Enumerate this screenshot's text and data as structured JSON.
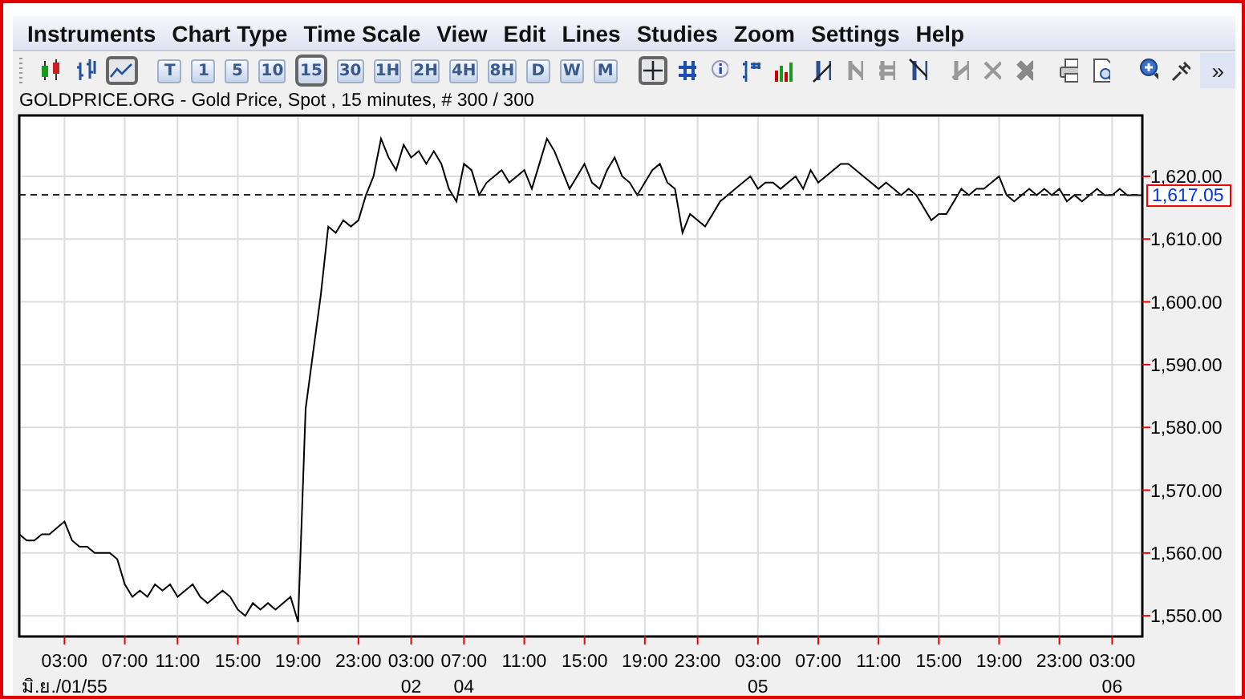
{
  "menu": [
    "Instruments",
    "Chart Type",
    "Time Scale",
    "View",
    "Edit",
    "Lines",
    "Studies",
    "Zoom",
    "Settings",
    "Help"
  ],
  "chart_types": [
    {
      "selected": false
    },
    {
      "selected": false
    },
    {
      "selected": true
    }
  ],
  "timescales": [
    {
      "label": "T",
      "selected": false
    },
    {
      "label": "1",
      "selected": false
    },
    {
      "label": "5",
      "selected": false
    },
    {
      "label": "10",
      "selected": false
    },
    {
      "label": "15",
      "selected": true
    },
    {
      "label": "30",
      "selected": false
    },
    {
      "label": "1H",
      "selected": false
    },
    {
      "label": "2H",
      "selected": false
    },
    {
      "label": "4H",
      "selected": false
    },
    {
      "label": "8H",
      "selected": false
    },
    {
      "label": "D",
      "selected": false
    },
    {
      "label": "W",
      "selected": false
    },
    {
      "label": "M",
      "selected": false
    }
  ],
  "crosshair": {
    "selected": true
  },
  "overflow": "»",
  "chart": {
    "title": "GOLDPRICE.ORG - Gold Price, Spot , 15 minutes, # 300 / 300",
    "time_labels": [
      "03:00",
      "07:00",
      "11:00",
      "15:00",
      "19:00",
      "23:00",
      "03:00",
      "07:00",
      "11:00",
      "15:00",
      "19:00",
      "23:00",
      "03:00",
      "07:00",
      "11:00",
      "15:00",
      "19:00",
      "23:00",
      "03:00"
    ],
    "date_labels": [
      "มิ.ย./01/55",
      "02",
      "04",
      "05",
      "06"
    ],
    "chart_data": {
      "type": "line",
      "grid": true,
      "ylim": [
        1546.7,
        1629.7
      ],
      "ref_lines": [
        {
          "axis": "y",
          "value": 1617.05,
          "label": "1,617.05"
        }
      ],
      "yticks": [
        {
          "value": 1550,
          "label": "1,550.00"
        },
        {
          "value": 1560,
          "label": "1,560.00"
        },
        {
          "value": 1570,
          "label": "1,570.00"
        },
        {
          "value": 1580,
          "label": "1,580.00"
        },
        {
          "value": 1590,
          "label": "1,590.00"
        },
        {
          "value": 1600,
          "label": "1,600.00"
        },
        {
          "value": 1610,
          "label": "1,610.00"
        },
        {
          "value": 1620,
          "label": "1,620.00"
        }
      ],
      "series": [
        {
          "color": "#000000",
          "values": [
            1563,
            1562,
            1562,
            1563,
            1563,
            1564,
            1565,
            1562,
            1561,
            1561,
            1560,
            1560,
            1560,
            1559,
            1555,
            1553,
            1554,
            1553,
            1555,
            1554,
            1555,
            1553,
            1554,
            1555,
            1553,
            1552,
            1553,
            1554,
            1553,
            1551,
            1550,
            1552,
            1551,
            1552,
            1551,
            1552,
            1553,
            1549,
            1583,
            1592,
            1601,
            1612,
            1611,
            1613,
            1612,
            1613,
            1617,
            1620,
            1626,
            1623,
            1621,
            1625,
            1623,
            1624,
            1622,
            1624,
            1622,
            1618,
            1616,
            1622,
            1621,
            1617,
            1619,
            1620,
            1621,
            1619,
            1620,
            1621,
            1618,
            1622,
            1626,
            1624,
            1621,
            1618,
            1620,
            1622,
            1619,
            1618,
            1621,
            1623,
            1620,
            1619,
            1617,
            1619,
            1621,
            1622,
            1619,
            1618,
            1611,
            1614,
            1613,
            1612,
            1614,
            1616,
            1617,
            1618,
            1619,
            1620,
            1618,
            1619,
            1619,
            1618,
            1619,
            1620,
            1618,
            1621,
            1619,
            1620,
            1621,
            1622,
            1622,
            1621,
            1620,
            1619,
            1618,
            1619,
            1618,
            1617,
            1618,
            1617,
            1615,
            1613,
            1614,
            1614,
            1616,
            1618,
            1617,
            1618,
            1618,
            1619,
            1620,
            1617,
            1616,
            1617,
            1618,
            1617,
            1618,
            1617,
            1618,
            1616,
            1617,
            1616,
            1617,
            1618,
            1617,
            1617,
            1618,
            1617,
            1617,
            1617
          ]
        }
      ]
    }
  }
}
